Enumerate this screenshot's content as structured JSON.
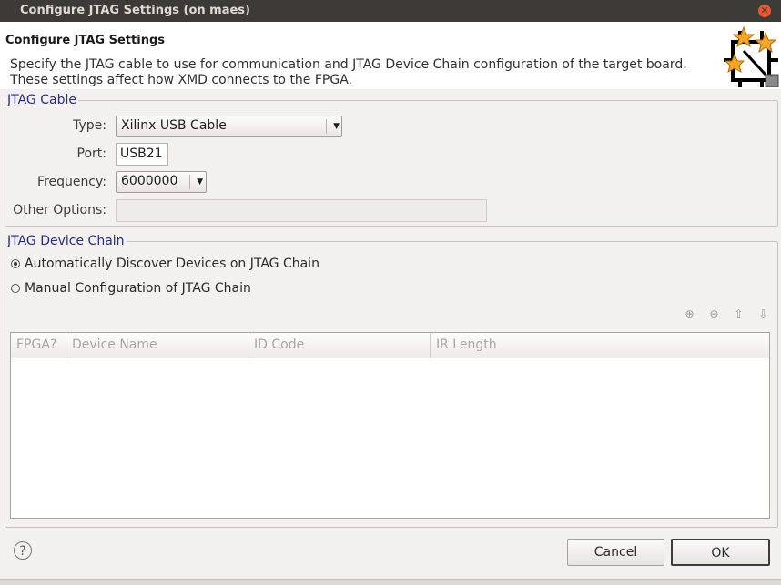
{
  "window": {
    "title": "Configure JTAG Settings  (on maes)"
  },
  "header": {
    "title": "Configure JTAG Settings",
    "description_line1": "Specify the JTAG cable to use for communication and JTAG Device Chain configuration of the target board.",
    "description_line2": "These settings affect how XMD connects to the FPGA."
  },
  "jtag_cable": {
    "group_label": "JTAG Cable",
    "type_label": "Type:",
    "type_value": "Xilinx USB Cable",
    "port_label": "Port:",
    "port_value": "USB21",
    "frequency_label": "Frequency:",
    "frequency_value": "6000000",
    "other_options_label": "Other Options:",
    "other_options_value": ""
  },
  "device_chain": {
    "group_label": "JTAG Device Chain",
    "radio_auto": "Automatically Discover Devices on JTAG Chain",
    "radio_manual": "Manual Configuration of JTAG Chain",
    "selected": "auto",
    "columns": [
      "FPGA?",
      "Device Name",
      "ID Code",
      "IR Length"
    ],
    "rows": []
  },
  "footer": {
    "help_label": "?",
    "cancel_label": "Cancel",
    "ok_label": "OK"
  },
  "icons": [
    "close-icon",
    "wizard-stars-icon",
    "add-device-icon",
    "remove-device-icon",
    "move-up-icon",
    "move-down-icon",
    "help-icon",
    "dropdown-arrow-icon"
  ],
  "colors": {
    "titlebar": "#3c3b37",
    "group_label": "#2a2a84",
    "close": "#e9572b"
  }
}
